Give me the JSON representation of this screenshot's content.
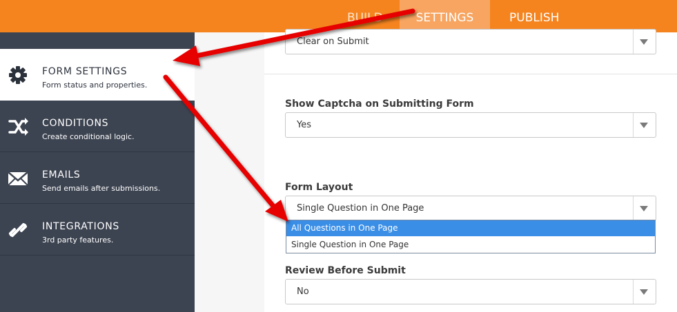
{
  "topnav": {
    "tabs": [
      {
        "label": "BUILD"
      },
      {
        "label": "SETTINGS"
      },
      {
        "label": "PUBLISH"
      }
    ]
  },
  "sidebar": {
    "items": [
      {
        "title": "FORM SETTINGS",
        "subtitle": "Form status and properties.",
        "icon": "gear-icon"
      },
      {
        "title": "CONDITIONS",
        "subtitle": "Create conditional logic.",
        "icon": "conditions-icon"
      },
      {
        "title": "EMAILS",
        "subtitle": "Send emails after submissions.",
        "icon": "envelope-icon"
      },
      {
        "title": "INTEGRATIONS",
        "subtitle": "3rd party features.",
        "icon": "link-icon"
      }
    ]
  },
  "main": {
    "after_submit_select": {
      "value": "Clear on Submit"
    },
    "captcha": {
      "label": "Show Captcha on Submitting Form",
      "value": "Yes"
    },
    "layout": {
      "label": "Form Layout",
      "value": "Single Question in One Page",
      "options": [
        "All Questions in One Page",
        "Single Question in One Page"
      ]
    },
    "review": {
      "label": "Review Before Submit",
      "value": "No"
    }
  },
  "colors": {
    "topbar": "#f5841f",
    "active_tab": "#f7a561",
    "sidebar": "#3d4451",
    "highlight": "#3a8ee6",
    "arrow": "#e60000"
  }
}
